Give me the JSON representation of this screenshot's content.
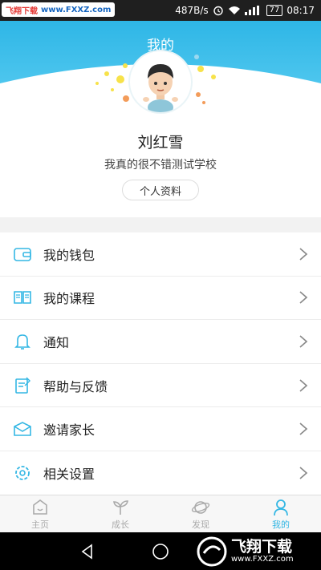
{
  "status_bar": {
    "watermark_left": "飞翔下载",
    "watermark_right": "www.FXXZ.com",
    "speed": "487B/s",
    "battery": "77",
    "time": "08:17"
  },
  "header": {
    "title": "我的",
    "name": "刘红雪",
    "school": "我真的很不错测试学校",
    "profile_button": "个人资料"
  },
  "menu": {
    "items": [
      {
        "label": "我的钱包",
        "icon": "wallet-icon"
      },
      {
        "label": "我的课程",
        "icon": "book-icon"
      },
      {
        "label": "通知",
        "icon": "bell-icon"
      },
      {
        "label": "帮助与反馈",
        "icon": "feedback-icon"
      },
      {
        "label": "邀请家长",
        "icon": "envelope-icon"
      },
      {
        "label": "相关设置",
        "icon": "gear-icon"
      }
    ]
  },
  "tabbar": {
    "tabs": [
      {
        "label": "主页",
        "icon": "home-icon"
      },
      {
        "label": "成长",
        "icon": "sprout-icon"
      },
      {
        "label": "发现",
        "icon": "planet-icon"
      },
      {
        "label": "我的",
        "icon": "person-icon",
        "active": true
      }
    ]
  },
  "watermark": {
    "brand": "飞翔下载",
    "url": "www.FXXZ.com"
  },
  "colors": {
    "accent": "#34b7e4",
    "header_gradient_start": "#2eb6e6",
    "header_gradient_end": "#4dc6ee"
  }
}
